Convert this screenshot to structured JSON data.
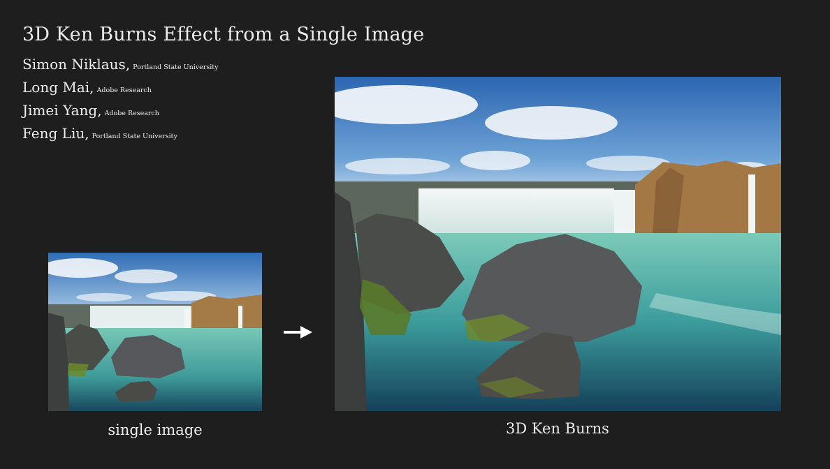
{
  "title": "3D Ken Burns Effect from a Single Image",
  "authors": [
    {
      "name": "Simon Niklaus,",
      "affiliation": "Portland State University"
    },
    {
      "name": "Long Mai,",
      "affiliation": "Adobe Research"
    },
    {
      "name": "Jimei Yang,",
      "affiliation": "Adobe Research"
    },
    {
      "name": "Feng Liu,",
      "affiliation": "Portland State University"
    }
  ],
  "captions": {
    "input": "single image",
    "output": "3D Ken Burns"
  },
  "colors": {
    "background": "#1e1e1f",
    "text": "#ececec",
    "sky": "#3d7fc4",
    "water": "#5fb8a8",
    "cliff": "#a07a4a"
  },
  "icons": {
    "arrow": "right-arrow-icon"
  }
}
